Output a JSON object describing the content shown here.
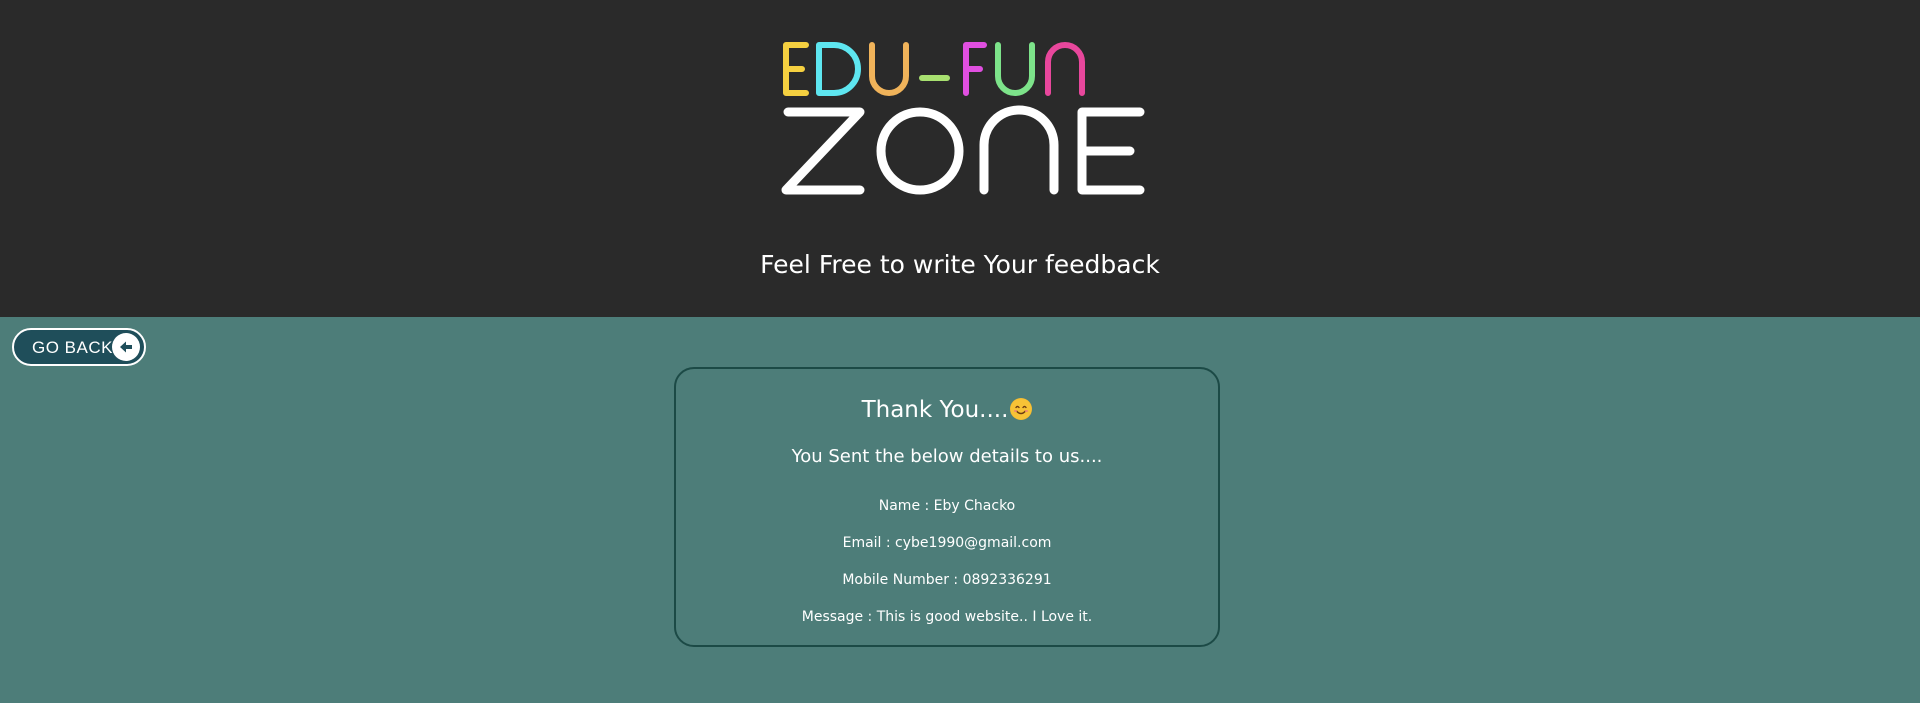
{
  "logo": {
    "line1": "EDU-FUN",
    "line2": "ZONE",
    "colors": [
      "#f5d040",
      "#5ee6f0",
      "#f0b35a",
      "#a8e070",
      "#e04fe0",
      "#7de38a",
      "#8ad96c",
      "#e8479c"
    ]
  },
  "header": {
    "tagline": "Feel Free to write Your feedback"
  },
  "back_button": {
    "label": "GO BACK",
    "icon": "back-arrow-icon"
  },
  "confirmation": {
    "title": "Thank You....",
    "emoji": "smiling-face-icon",
    "subtitle": "You Sent the below details to us....",
    "fields": [
      {
        "text": "Name : Eby Chacko"
      },
      {
        "text": "Email : cybe1990@gmail.com"
      },
      {
        "text": "Mobile Number : 0892336291"
      },
      {
        "text": "Message : This is good website.. I Love it."
      }
    ]
  },
  "colors": {
    "header_bg": "#2a2a2a",
    "page_bg": "#4d7d79",
    "button_bg": "#1f4e5a",
    "card_border": "#1c4a46"
  }
}
